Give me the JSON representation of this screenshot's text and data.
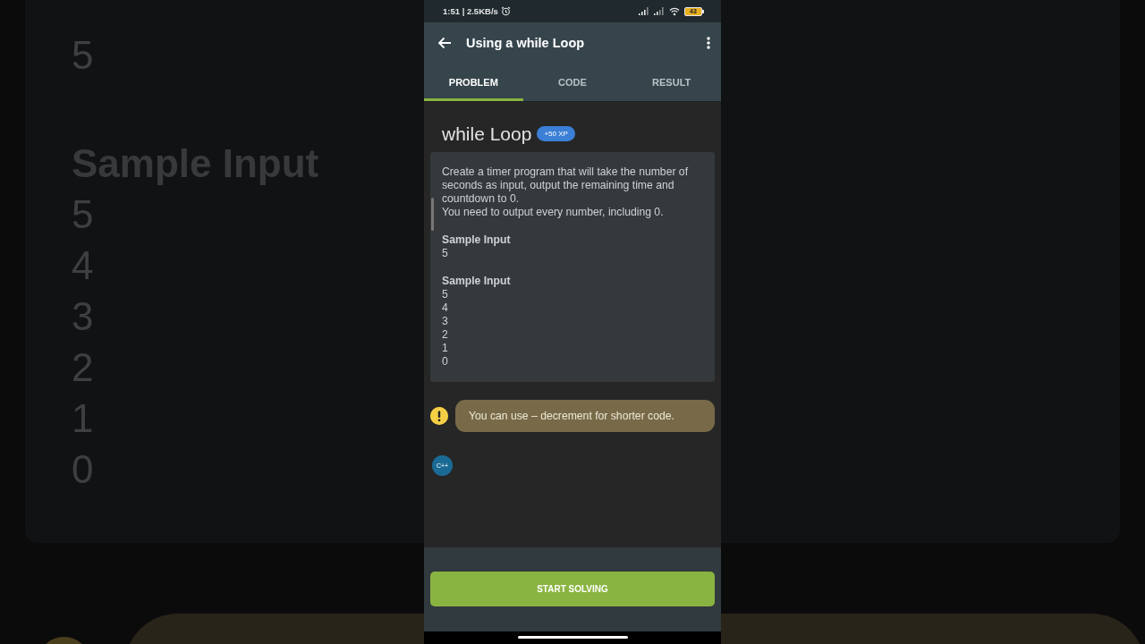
{
  "backdrop": {
    "lines": [
      {
        "kind": "value",
        "text": "5"
      },
      {
        "kind": "heading",
        "text": "Sample Input"
      },
      {
        "kind": "value",
        "text": "5"
      },
      {
        "kind": "value",
        "text": "4"
      },
      {
        "kind": "value",
        "text": "3"
      },
      {
        "kind": "value",
        "text": "2"
      },
      {
        "kind": "value",
        "text": "1"
      },
      {
        "kind": "value",
        "text": "0"
      }
    ]
  },
  "status_bar": {
    "time": "1:51 | 2.5KB/s",
    "battery": "43"
  },
  "app_bar": {
    "title": "Using a while Loop"
  },
  "tabs": [
    {
      "label": "PROBLEM",
      "selected": true
    },
    {
      "label": "CODE",
      "selected": false
    },
    {
      "label": "RESULT",
      "selected": false
    }
  ],
  "lesson": {
    "title": "while Loop",
    "xp_badge": "+50 XP",
    "description": [
      "Create a timer program that will take the number of seconds as input, output the remaining time and countdown to 0.",
      "You need to output every number, including 0."
    ],
    "samples": [
      {
        "heading": "Sample Input",
        "lines": [
          "5"
        ]
      },
      {
        "heading": "Sample Input",
        "lines": [
          "5",
          "4",
          "3",
          "2",
          "1",
          "0"
        ]
      }
    ]
  },
  "hint": {
    "text": "You can use – decrement for shorter code."
  },
  "language_badge": "C++",
  "primary_button": "START SOLVING"
}
